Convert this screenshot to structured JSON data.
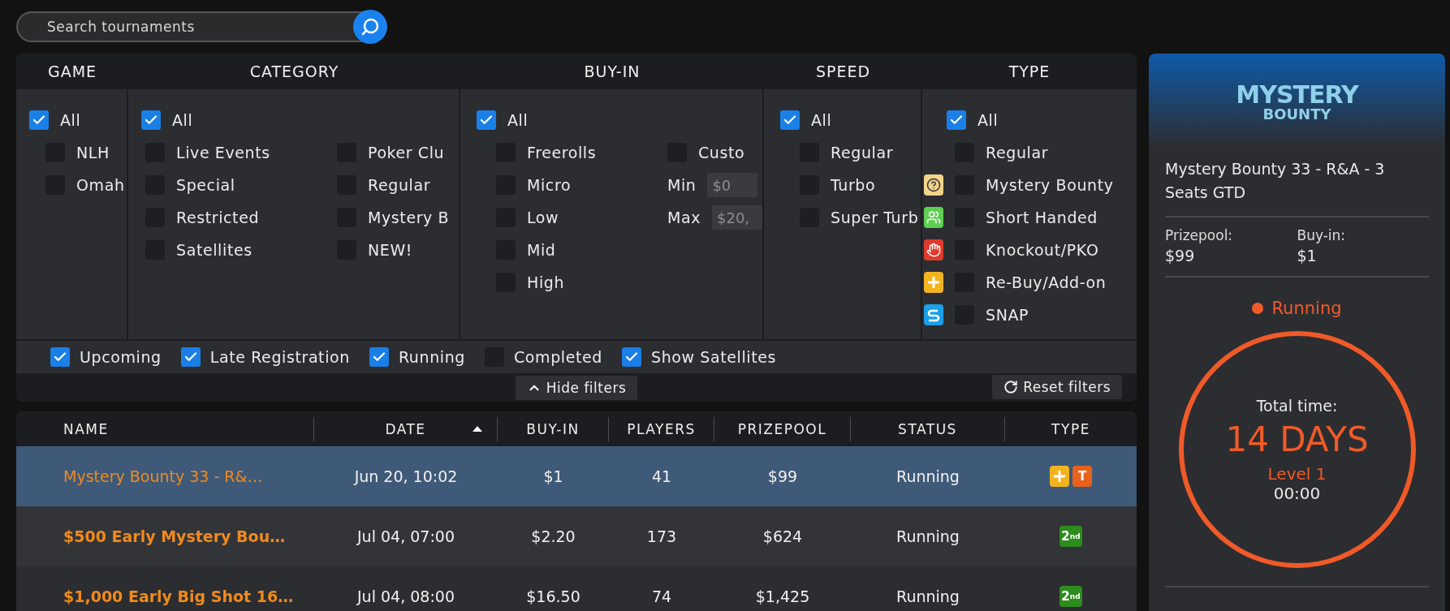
{
  "search": {
    "placeholder": "Search tournaments"
  },
  "filters": {
    "columns": [
      {
        "heading": "GAME",
        "all": {
          "label": "All",
          "checked": true
        },
        "lists": [
          [
            {
              "label": "NLH",
              "checked": false
            },
            {
              "label": "Omah",
              "checked": false
            }
          ]
        ]
      },
      {
        "heading": "CATEGORY",
        "all": {
          "label": "All",
          "checked": true
        },
        "lists": [
          [
            {
              "label": "Live Events",
              "checked": false
            },
            {
              "label": "Special",
              "checked": false
            },
            {
              "label": "Restricted",
              "checked": false
            },
            {
              "label": "Satellites",
              "checked": false
            }
          ],
          [
            {
              "label": "Poker Clu",
              "checked": false
            },
            {
              "label": "Regular",
              "checked": false
            },
            {
              "label": "Mystery B",
              "checked": false
            },
            {
              "label": "NEW!",
              "checked": false
            }
          ]
        ]
      },
      {
        "heading": "BUY-IN",
        "all": {
          "label": "All",
          "checked": true
        },
        "lists": [
          [
            {
              "label": "Freerolls",
              "checked": false
            },
            {
              "label": "Micro",
              "checked": false
            },
            {
              "label": "Low",
              "checked": false
            },
            {
              "label": "Mid",
              "checked": false
            },
            {
              "label": "High",
              "checked": false
            }
          ]
        ],
        "custom": {
          "label": "Custo",
          "checked": false,
          "min": {
            "label": "Min",
            "placeholder": "$0"
          },
          "max": {
            "label": "Max",
            "placeholder": "$20,"
          }
        }
      },
      {
        "heading": "SPEED",
        "all": {
          "label": "All",
          "checked": true
        },
        "lists": [
          [
            {
              "label": "Regular",
              "checked": false
            },
            {
              "label": "Turbo",
              "checked": false
            },
            {
              "label": "Super Turb",
              "checked": false
            }
          ]
        ]
      },
      {
        "heading": "TYPE",
        "all": {
          "label": "All",
          "checked": true
        },
        "lists": [
          [
            {
              "label": "Regular",
              "checked": false,
              "kind": "plain"
            },
            {
              "label": "Mystery Bounty",
              "checked": false,
              "kind": "mystery"
            },
            {
              "label": "Short Handed",
              "checked": false,
              "kind": "shorthanded"
            },
            {
              "label": "Knockout/PKO",
              "checked": false,
              "kind": "knockout"
            },
            {
              "label": "Re-Buy/Add-on",
              "checked": false,
              "kind": "rebuy"
            },
            {
              "label": "SNAP",
              "checked": false,
              "kind": "snap"
            }
          ]
        ]
      }
    ],
    "status_filters": [
      {
        "label": "Upcoming",
        "checked": true
      },
      {
        "label": "Late Registration",
        "checked": true
      },
      {
        "label": "Running",
        "checked": true
      },
      {
        "label": "Completed",
        "checked": false
      },
      {
        "label": "Show Satellites",
        "checked": true
      }
    ],
    "hide_button": "Hide filters",
    "reset_button": "Reset filters"
  },
  "table": {
    "columns": [
      {
        "label": "NAME",
        "sorted": false
      },
      {
        "label": "DATE",
        "sorted": true
      },
      {
        "label": "BUY-IN",
        "sorted": false
      },
      {
        "label": "PLAYERS",
        "sorted": false
      },
      {
        "label": "PRIZEPOOL",
        "sorted": false
      },
      {
        "label": "STATUS",
        "sorted": false
      },
      {
        "label": "TYPE",
        "sorted": false
      }
    ],
    "rows": [
      {
        "name": "Mystery Bounty 33 - R&…",
        "date": "Jun 20, 10:02",
        "buy_in": "$1",
        "players": "41",
        "prizepool": "$99",
        "status": "Running",
        "selected": true,
        "types": [
          {
            "kind": "rebuy"
          },
          {
            "kind": "text",
            "label": "T",
            "color": "#e8621c"
          }
        ]
      },
      {
        "name": "$500 Early Mystery Bou…",
        "date": "Jul 04, 07:00",
        "buy_in": "$2.20",
        "players": "173",
        "prizepool": "$624",
        "status": "Running",
        "selected": false,
        "types": [
          {
            "kind": "text",
            "label": "2$^{nd}$",
            "color": "#2e8b1e"
          }
        ]
      },
      {
        "name": "$1,000 Early Big Shot 16…",
        "date": "Jul 04, 08:00",
        "buy_in": "$16.50",
        "players": "74",
        "prizepool": "$1,425",
        "status": "Running",
        "selected": false,
        "types": [
          {
            "kind": "text",
            "label": "2$^{nd}$",
            "color": "#2e8b1e"
          }
        ]
      }
    ]
  },
  "details": {
    "logo": [
      "MYSTERY",
      "BOUNTY"
    ],
    "title": "Mystery Bounty 33 - R&A - 3 Seats GTD",
    "stats": [
      {
        "label": "Prizepool:",
        "value": "$99"
      },
      {
        "label": "Buy-in:",
        "value": "$1"
      }
    ],
    "status": {
      "label": "Running",
      "color": "#f05a28"
    },
    "timer": {
      "label": "Total time:",
      "value": "14 DAYS",
      "level": "Level 1",
      "clock": "00:00"
    }
  }
}
